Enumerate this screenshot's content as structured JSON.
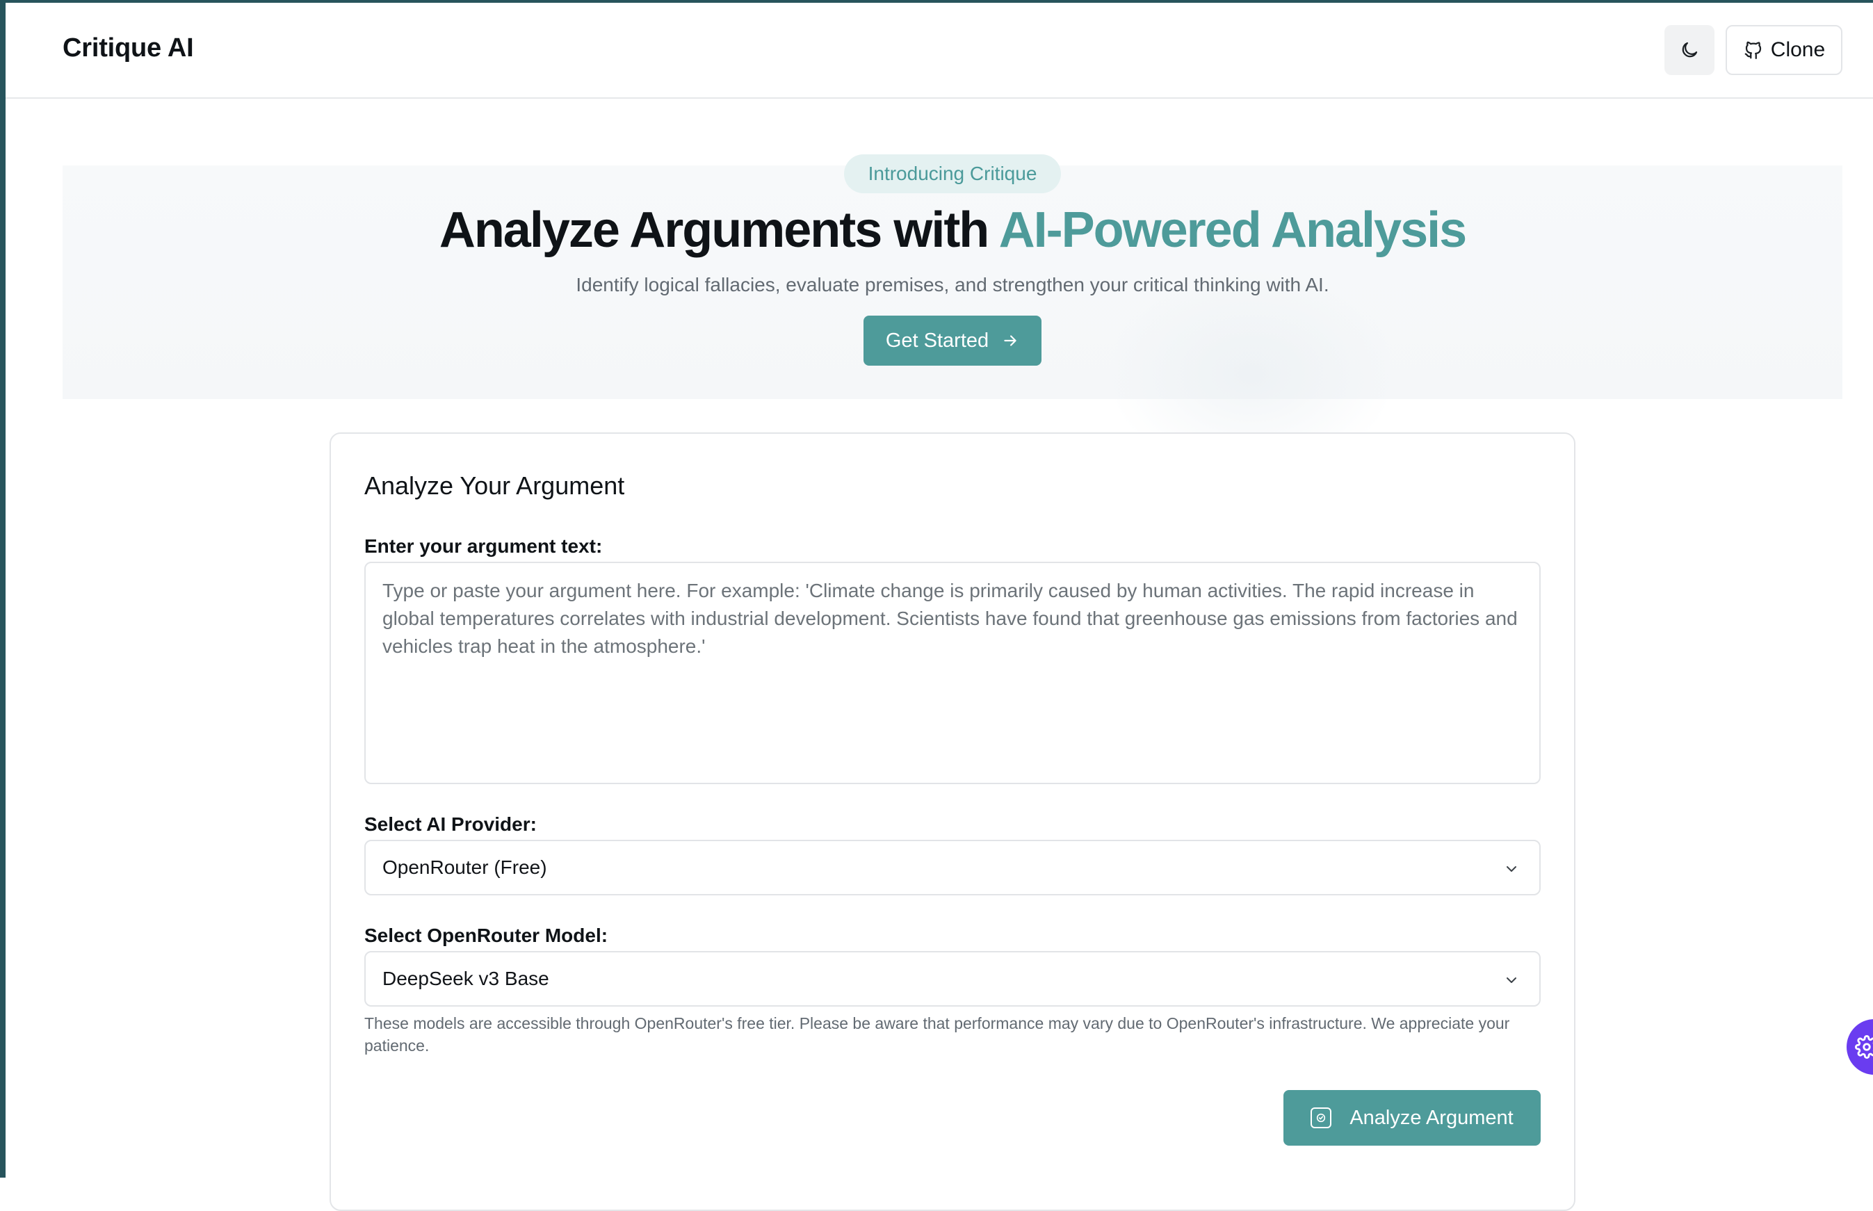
{
  "colors": {
    "brand_dark": "#27545c",
    "accent_teal": "#4e9b9a",
    "pill_bg": "#e4f1f1",
    "floating_purple": "#6a3cf0"
  },
  "header": {
    "brand": "Critique AI",
    "theme_toggle_icon": "moon-icon",
    "clone_label": "Clone",
    "clone_icon": "github-icon"
  },
  "hero": {
    "badge": "Introducing Critique",
    "title_plain": "Analyze Arguments with ",
    "title_accent": "AI-Powered Analysis",
    "subtitle": "Identify logical fallacies, evaluate premises, and strengthen your critical thinking with AI.",
    "cta_label": "Get Started",
    "cta_icon": "arrow-right-icon"
  },
  "card": {
    "title": "Analyze Your Argument",
    "argument_label": "Enter your argument text:",
    "argument_placeholder": "Type or paste your argument here. For example: 'Climate change is primarily caused by human activities. The rapid increase in global temperatures correlates with industrial development. Scientists have found that greenhouse gas emissions from factories and vehicles trap heat in the atmosphere.'",
    "provider_label": "Select AI Provider:",
    "provider_value": "OpenRouter (Free)",
    "model_label": "Select OpenRouter Model:",
    "model_value": "DeepSeek v3 Base",
    "note": "These models are accessible through OpenRouter's free tier. Please be aware that performance may vary due to OpenRouter's infrastructure. We appreciate your patience.",
    "analyze_label": "Analyze Argument",
    "analyze_icon": "check-badge-icon"
  },
  "floating_widget_icon": "gear-icon"
}
